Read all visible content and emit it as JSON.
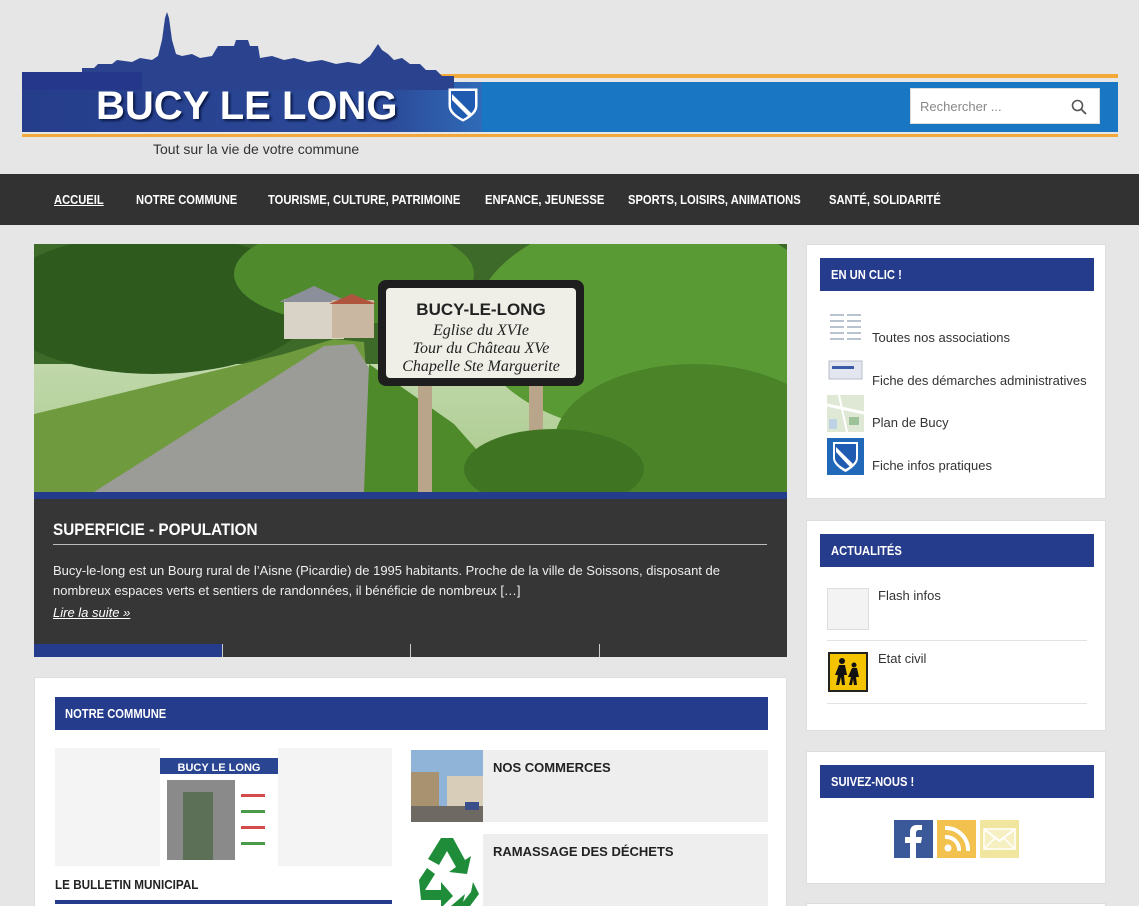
{
  "site": {
    "title": "BUCY LE LONG",
    "tagline": "Tout sur la vie de votre commune",
    "logo_icon": "coat-of-arms-icon"
  },
  "search": {
    "placeholder": "Rechercher ...",
    "icon": "search-icon"
  },
  "nav": {
    "items": [
      {
        "label": "ACCUEIL",
        "active": true
      },
      {
        "label": "NOTRE COMMUNE"
      },
      {
        "label": "TOURISME, CULTURE, PATRIMOINE"
      },
      {
        "label": "ENFANCE, JEUNESSE"
      },
      {
        "label": "SPORTS, LOISIRS, ANIMATIONS"
      },
      {
        "label": "SANTÉ, SOLIDARITÉ"
      }
    ]
  },
  "slider": {
    "sign_lines": [
      "BUCY-LE-LONG",
      "Eglise du XVIe",
      "Tour du Château XVe",
      "Chapelle Ste Marguerite"
    ],
    "title": "SUPERFICIE - POPULATION",
    "excerpt": "Bucy-le-long est un Bourg rural de l’Aisne (Picardie) de 1995 habitants. Proche de la ville de Soissons, disposant de nombreux espaces verts et sentiers de randonnées, il bénéficie de nombreux […]",
    "read_more": "Lire la suite »",
    "active_slide": 1,
    "slide_count": 4
  },
  "commune": {
    "heading": "NOTRE COMMUNE",
    "featured_title": "LE BULLETIN MUNICIPAL",
    "featured_cover_title": "BUCY LE LONG",
    "posts": [
      {
        "title": "NOS COMMERCES"
      },
      {
        "title": "RAMASSAGE DES DÉCHETS"
      }
    ]
  },
  "sidebar": {
    "clic": {
      "heading": "EN UN CLIC !",
      "items": [
        {
          "label": "Toutes nos associations"
        },
        {
          "label": "Fiche des démarches administratives"
        },
        {
          "label": "Plan de Bucy"
        },
        {
          "label": "Fiche infos pratiques"
        }
      ]
    },
    "actu": {
      "heading": "ACTUALITÉS",
      "items": [
        {
          "label": "Flash infos"
        },
        {
          "label": "Etat civil"
        }
      ]
    },
    "social": {
      "heading": "SUIVEZ-NOUS !",
      "icons": [
        "facebook-icon",
        "rss-icon",
        "email-icon"
      ]
    }
  },
  "colors": {
    "brand_blue": "#253b8c",
    "band_blue": "#1976c2",
    "accent_orange": "#f2a93a",
    "nav_dark": "#323232"
  }
}
